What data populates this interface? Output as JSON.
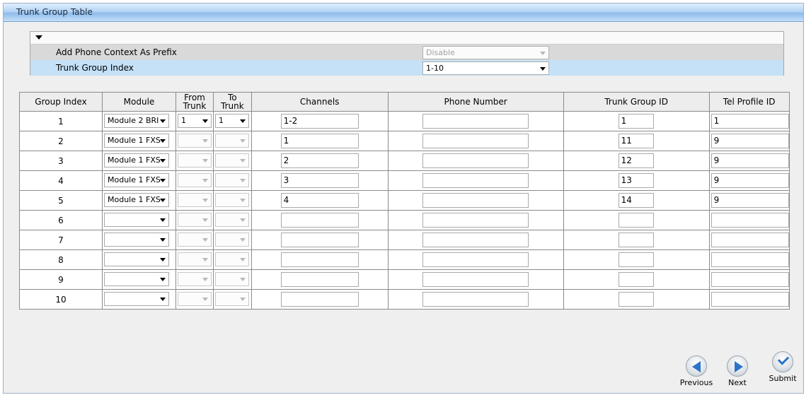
{
  "window": {
    "title": "Trunk Group Table"
  },
  "params": {
    "add_phone_context": {
      "label": "Add Phone Context As Prefix",
      "value": "Disable"
    },
    "trunk_group_index": {
      "label": "Trunk Group Index",
      "value": "1-10"
    }
  },
  "table": {
    "headers": {
      "group_index": "Group Index",
      "module": "Module",
      "from_trunk": "From Trunk",
      "to_trunk": "To Trunk",
      "channels": "Channels",
      "phone_number": "Phone Number",
      "trunk_group_id": "Trunk Group ID",
      "tel_profile_id": "Tel Profile ID"
    },
    "rows": [
      {
        "index": "1",
        "module": "Module 2 BRI",
        "from": "1",
        "to": "1",
        "channels": "1-2",
        "phone": "",
        "tgid": "1",
        "tel": "1"
      },
      {
        "index": "2",
        "module": "Module 1 FXS",
        "from": "",
        "to": "",
        "channels": "1",
        "phone": "",
        "tgid": "11",
        "tel": "9"
      },
      {
        "index": "3",
        "module": "Module 1 FXS",
        "from": "",
        "to": "",
        "channels": "2",
        "phone": "",
        "tgid": "12",
        "tel": "9"
      },
      {
        "index": "4",
        "module": "Module 1 FXS",
        "from": "",
        "to": "",
        "channels": "3",
        "phone": "",
        "tgid": "13",
        "tel": "9"
      },
      {
        "index": "5",
        "module": "Module 1 FXS",
        "from": "",
        "to": "",
        "channels": "4",
        "phone": "",
        "tgid": "14",
        "tel": "9"
      },
      {
        "index": "6",
        "module": "",
        "from": "",
        "to": "",
        "channels": "",
        "phone": "",
        "tgid": "",
        "tel": ""
      },
      {
        "index": "7",
        "module": "",
        "from": "",
        "to": "",
        "channels": "",
        "phone": "",
        "tgid": "",
        "tel": ""
      },
      {
        "index": "8",
        "module": "",
        "from": "",
        "to": "",
        "channels": "",
        "phone": "",
        "tgid": "",
        "tel": ""
      },
      {
        "index": "9",
        "module": "",
        "from": "",
        "to": "",
        "channels": "",
        "phone": "",
        "tgid": "",
        "tel": ""
      },
      {
        "index": "10",
        "module": "",
        "from": "",
        "to": "",
        "channels": "",
        "phone": "",
        "tgid": "",
        "tel": ""
      }
    ]
  },
  "buttons": {
    "previous": "Previous",
    "next": "Next",
    "submit": "Submit"
  },
  "colors": {
    "accent": "#2b74c9",
    "selected_row": "#c4e1f7",
    "title_bar": "#b4d4f4"
  }
}
